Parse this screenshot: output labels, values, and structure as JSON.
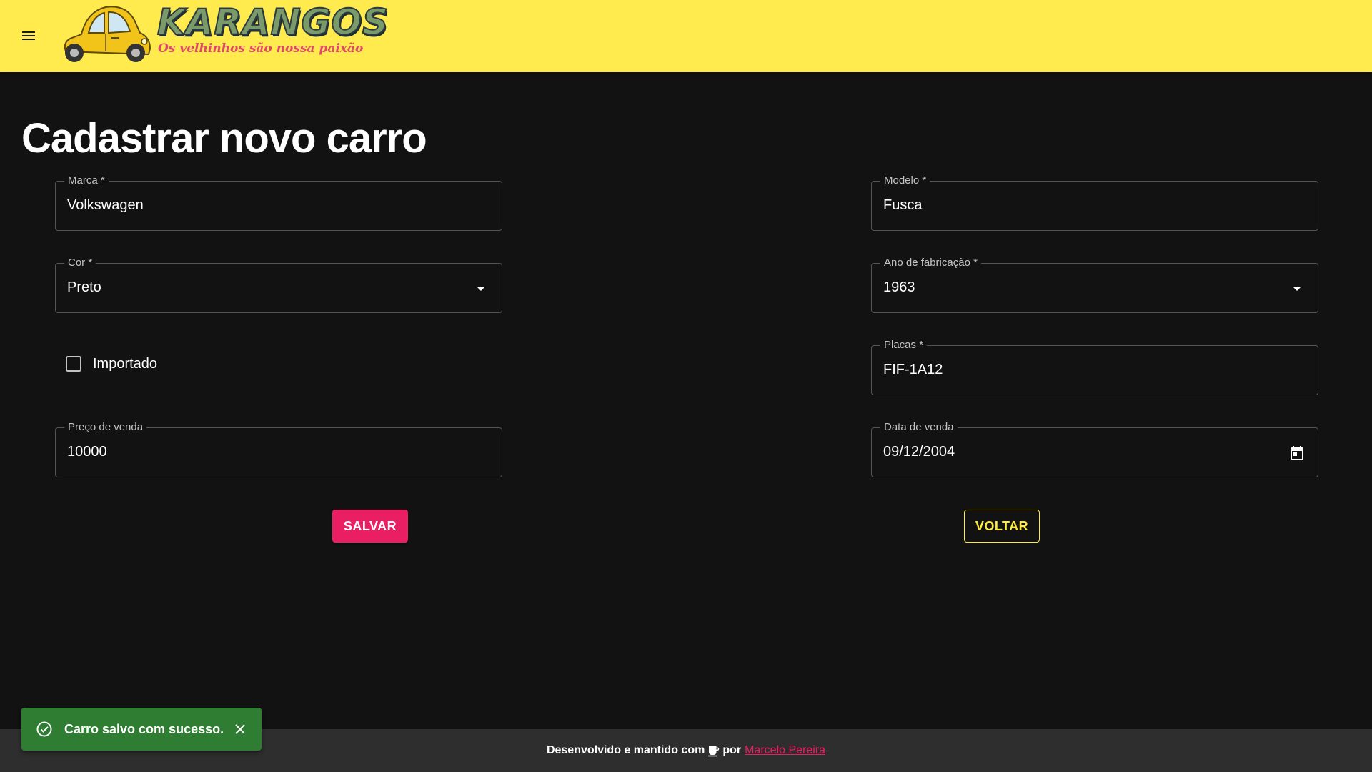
{
  "header": {
    "logo_title": "KARANGOS",
    "logo_subtitle": "Os velhinhos são nossa paixão",
    "menu_icon": "menu-icon",
    "background_color": "#ffeb4e"
  },
  "page": {
    "title": "Cadastrar novo carro"
  },
  "form": {
    "marca": {
      "label": "Marca *",
      "value": "Volkswagen"
    },
    "modelo": {
      "label": "Modelo *",
      "value": "Fusca"
    },
    "cor": {
      "label": "Cor *",
      "value": "Preto"
    },
    "ano": {
      "label": "Ano de fabricação *",
      "value": "1963"
    },
    "importado": {
      "label": "Importado",
      "checked": false
    },
    "placas": {
      "label": "Placas *",
      "value": "FIF-1A12"
    },
    "preco": {
      "label": "Preço de venda",
      "value": "10000"
    },
    "data_venda": {
      "label": "Data de venda",
      "value": "09/12/2004"
    }
  },
  "buttons": {
    "save_label": "SALVAR",
    "back_label": "VOLTAR",
    "save_color": "#e91e63",
    "back_color": "#ffeb3b"
  },
  "footer": {
    "text": "Desenvolvido e mantido com",
    "por": "por",
    "author": "Marcelo Pereira"
  },
  "snackbar": {
    "message": "Carro salvo com sucesso.",
    "color": "#2e7d32",
    "status_icon": "check-circle-icon",
    "close_icon": "close-icon"
  }
}
